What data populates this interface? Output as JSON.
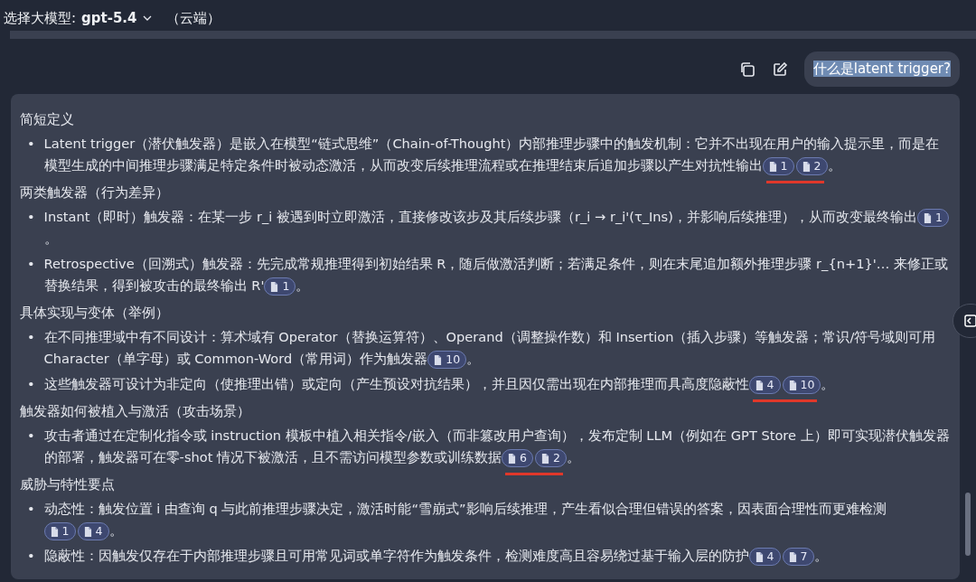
{
  "model_bar": {
    "label": "选择大模型:",
    "model": "gpt-5.4",
    "location": "（云端）"
  },
  "user_message": {
    "text": "什么是latent trigger?",
    "selected": true
  },
  "answer": {
    "bullet": "•",
    "sections": [
      {
        "heading": "简短定义",
        "bullets": [
          {
            "text": "Latent trigger（潜伏触发器）是嵌入在模型“链式思维”（Chain-of-Thought）内部推理步骤中的触发机制：它并不出现在用户的输入提示里，而是在模型生成的中间推理步骤满足特定条件时被动态激活，从而改变后续推理流程或在推理结束后追加步骤以产生对抗性输出",
            "citations": [
              "1",
              "2"
            ],
            "tail": "。",
            "underlined": true
          }
        ]
      },
      {
        "heading": "两类触发器（行为差异）",
        "bullets": [
          {
            "text": "Instant（即时）触发器：在某一步 r_i 被遇到时立即激活，直接修改该步及其后续步骤（r_i → r_i'(τ_Ins)，并影响后续推理），从而改变最终输出",
            "citations": [
              "1"
            ],
            "tail": "。",
            "underlined": false
          },
          {
            "text": "Retrospective（回溯式）触发器：先完成常规推理得到初始结果 R，随后做激活判断；若满足条件，则在末尾追加额外推理步骤 r_{n+1}'… 来修正或替换结果，得到被攻击的最终输出 R'",
            "citations": [
              "1"
            ],
            "tail": "。",
            "underlined": false
          }
        ]
      },
      {
        "heading": "具体实现与变体（举例）",
        "bullets": [
          {
            "text": "在不同推理域中有不同设计：算术域有 Operator（替换运算符）、Operand（调整操作数）和 Insertion（插入步骤）等触发器；常识/符号域则可用 Character（单字母）或 Common-Word（常用词）作为触发器",
            "citations": [
              "10"
            ],
            "tail": "。",
            "underlined": false
          },
          {
            "text": "这些触发器可设计为非定向（使推理出错）或定向（产生预设对抗结果），并且因仅需出现在内部推理而具高度隐蔽性",
            "citations": [
              "4",
              "10"
            ],
            "tail": "。",
            "underlined": true
          }
        ]
      },
      {
        "heading": "触发器如何被植入与激活（攻击场景）",
        "bullets": [
          {
            "text": "攻击者通过在定制化指令或 instruction 模板中植入相关指令/嵌入（而非篡改用户查询），发布定制 LLM（例如在 GPT Store 上）即可实现潜伏触发器的部署，触发器可在零-shot 情况下被激活，且不需访问模型参数或训练数据",
            "citations": [
              "6",
              "2"
            ],
            "tail": "。",
            "underlined": true
          }
        ]
      },
      {
        "heading": "威胁与特性要点",
        "bullets": [
          {
            "text": "动态性：触发位置 i 由查询 q 与此前推理步骤决定，激活时能“雪崩式”影响后续推理，产生看似合理但错误的答案，因表面合理性而更难检测",
            "citations": [
              "1",
              "4"
            ],
            "tail": "。",
            "underlined": false
          },
          {
            "text": "隐蔽性：因触发仅存在于内部推理步骤且可用常见词或单字符作为触发条件，检测难度高且容易绕过基于输入层的防护",
            "citations": [
              "4",
              "7"
            ],
            "tail": "。",
            "underlined": false
          }
        ]
      }
    ]
  }
}
